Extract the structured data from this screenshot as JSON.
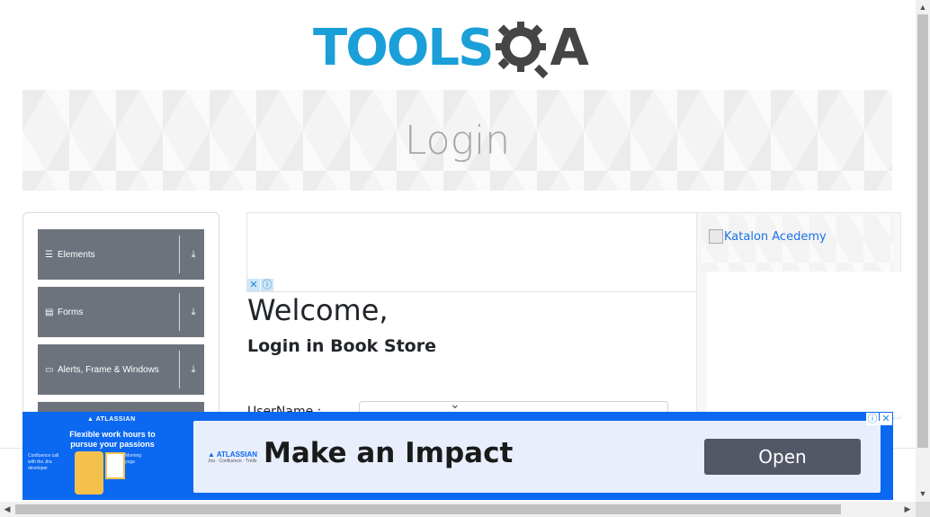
{
  "header": {
    "logo_text": "TOOLS",
    "logo_suffix": "A",
    "logo_alt": "TOOLSQA",
    "brand_blue": "#1a9fd8",
    "brand_dark": "#454545"
  },
  "banner": {
    "title": "Login"
  },
  "sidebar": {
    "groups": [
      {
        "label": "Elements",
        "icon": "hamburger-icon"
      },
      {
        "label": "Forms",
        "icon": "document-icon"
      },
      {
        "label": "Alerts, Frame & Windows",
        "icon": "window-icon"
      }
    ],
    "group_color": "#6c737d"
  },
  "main": {
    "welcome": "Welcome,",
    "subtitle": "Login in Book Store",
    "username_label": "UserName :",
    "ad_close": "✕",
    "ad_info": "ⓘ"
  },
  "right_ad": {
    "link_text": "Katalon Acedemy"
  },
  "bottom_ad": {
    "brand": "▲ ATLASSIAN",
    "sub_brand": "Jira · Confluence · Trello",
    "message": "Flexible work hours to pursue your passions",
    "left_caption": "Confluence call with the Jira developer",
    "right_caption": "Morning yoga",
    "headline": "Make an Impact",
    "cta": "Open",
    "background": "#0b68f0"
  }
}
